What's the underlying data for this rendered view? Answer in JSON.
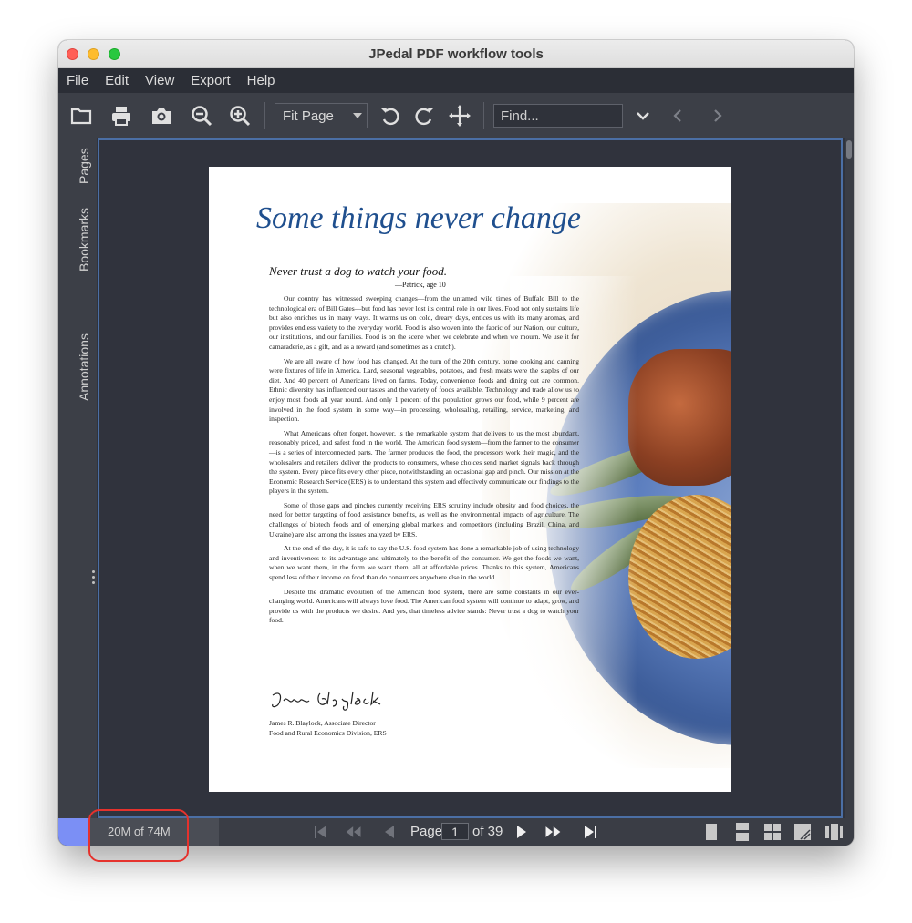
{
  "window": {
    "title": "JPedal PDF workflow tools"
  },
  "menu": [
    "File",
    "Edit",
    "View",
    "Export",
    "Help"
  ],
  "toolbar": {
    "icons": [
      "open-folder-icon",
      "print-icon",
      "snapshot-icon",
      "zoom-out-icon",
      "zoom-in-icon",
      "rotate-left-icon",
      "rotate-right-icon",
      "pan-icon"
    ],
    "zoom_value": "Fit Page",
    "find_placeholder": "Find..."
  },
  "side_tabs": [
    "Pages",
    "Bookmarks",
    "Annotations"
  ],
  "document": {
    "heading": "Some things never change",
    "quote": "Never trust a dog to watch your food.",
    "quote_attribution": "—Patrick, age 10",
    "paragraphs": [
      "Our country has witnessed sweeping changes—from the untamed wild times of Buffalo Bill to the technological era of Bill Gates—but food has never lost its central role in our lives. Food not only sustains life but also enriches us in many ways. It warms us on cold, dreary days, entices us with its many aromas, and provides endless variety to the everyday world. Food is also woven into the fabric of our Nation, our culture, our institutions, and our families. Food is on the scene when we celebrate and when we mourn. We use it for camaraderie, as a gift, and as a reward (and sometimes as a crutch).",
      "We are all aware of how food has changed. At the turn of the 20th century, home cooking and canning were fixtures of life in America. Lard, seasonal vegetables, potatoes, and fresh meats were the staples of our diet. And 40 percent of Americans lived on farms. Today, convenience foods and dining out are common. Ethnic diversity has influenced our tastes and the variety of foods available. Technology and trade allow us to enjoy most foods all year round. And only 1 percent of the population grows our food, while 9 percent are involved in the food system in some way—in processing, wholesaling, retailing, service, marketing, and inspection.",
      "What Americans often forget, however, is the remarkable system that delivers to us the most abundant, reasonably priced, and safest food in the world. The American food system—from the farmer to the consumer—is a series of interconnected parts. The farmer produces the food, the processors work their magic, and the wholesalers and retailers deliver the products to consumers, whose choices send market signals back through the system. Every piece fits every other piece, notwithstanding an occasional gap and pinch. Our mission at the Economic Research Service (ERS) is to understand this system and effectively communicate our findings to the players in the system.",
      "Some of those gaps and pinches currently receiving ERS scrutiny include obesity and food choices, the need for better targeting of food assistance benefits, as well as the environmental impacts of agriculture. The challenges of biotech foods and of emerging global markets and competitors (including Brazil, China, and Ukraine) are also among the issues analyzed by ERS.",
      "At the end of the day, it is safe to say the U.S. food system has done a remarkable job of using technology and inventiveness to its advantage and ultimately to the benefit of the consumer. We get the foods we want, when we want them, in the form we want them, all at affordable prices. Thanks to this system, Americans spend less of their income on food than do consumers anywhere else in the world.",
      "Despite the dramatic evolution of the American food system, there are some constants in our ever-changing world. Americans will always love food. The American food system will continue to adapt, grow, and provide us with the products we desire. And yes, that timeless advice stands: Never trust a dog to watch your food."
    ],
    "signature": "James Blaylock",
    "signer_line1": "James R. Blaylock, Associate Director",
    "signer_line2": "Food and Rural Economics Division, ERS"
  },
  "status": {
    "memory": "20M of 74M",
    "page_label": "Page",
    "current_page": "1",
    "total_pages": "of 39"
  },
  "colors": {
    "heading": "#1f4f8e",
    "accent": "#7b8ff5",
    "viewport_border": "#4b6fa5",
    "annotation": "#e5322d"
  }
}
